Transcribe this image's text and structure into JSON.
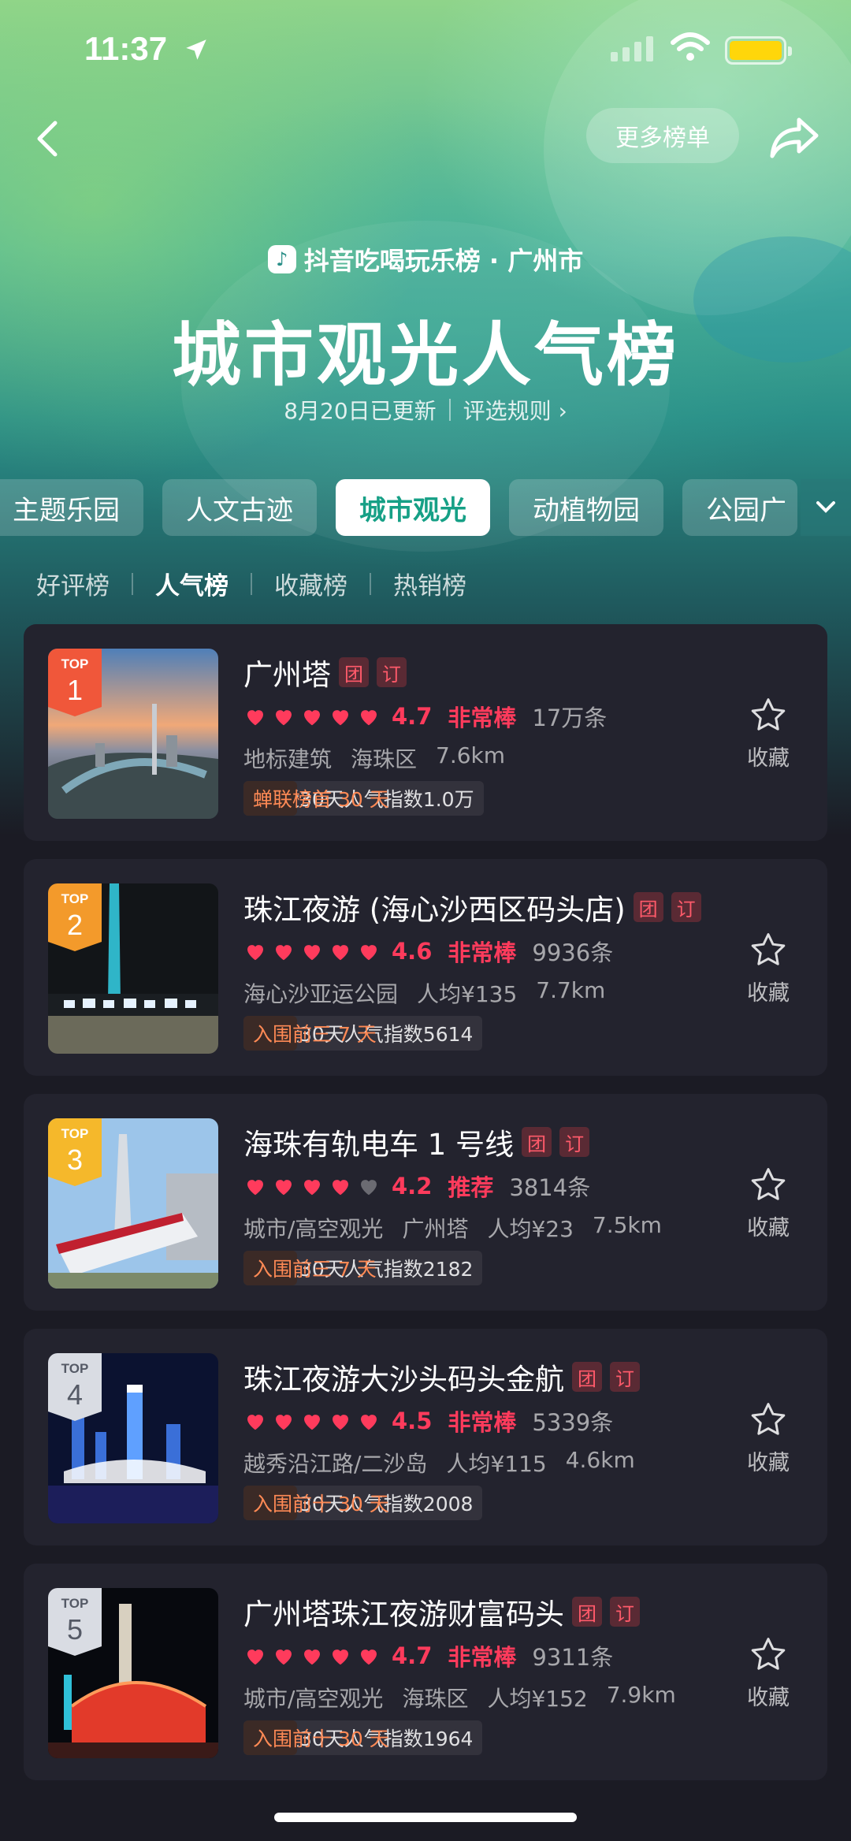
{
  "status_bar": {
    "time": "11:37"
  },
  "header": {
    "more_lists": "更多榜单",
    "brand": "抖音吃喝玩乐榜 · 广州市",
    "title": "城市观光人气榜",
    "updated": "8月20日已更新",
    "rules": "评选规则"
  },
  "categories": [
    "主题乐园",
    "人文古迹",
    "城市观光",
    "动植物园",
    "公园广"
  ],
  "active_category": "城市观光",
  "sub_tabs": [
    "好评榜",
    "人气榜",
    "收藏榜",
    "热销榜"
  ],
  "active_sub_tab": "人气榜",
  "favorite_label": "收藏",
  "top_label": "TOP",
  "tag_group": "团",
  "tag_order": "订",
  "items": [
    {
      "rank": "1",
      "name": "广州塔",
      "rating": 4.7,
      "score": "4.7",
      "level": "非常棒",
      "reviews": "17万条",
      "meta": [
        "地标建筑",
        "海珠区",
        "7.6km"
      ],
      "popularity": "近30天人气指数1.0万",
      "badge": "蝉联榜首 30 天",
      "rank_color": "#f0573a"
    },
    {
      "rank": "2",
      "name": "珠江夜游 (海心沙西区码头店)",
      "rating": 4.6,
      "score": "4.6",
      "level": "非常棒",
      "reviews": "9936条",
      "meta": [
        "海心沙亚运公园",
        "人均¥135",
        "7.7km"
      ],
      "popularity": "近30天人气指数5614",
      "badge": "入围前三 7 天",
      "rank_color": "#f39a2b"
    },
    {
      "rank": "3",
      "name": "海珠有轨电车 1 号线",
      "rating": 4.2,
      "score": "4.2",
      "level": "推荐",
      "reviews": "3814条",
      "meta": [
        "城市/高空观光",
        "广州塔",
        "人均¥23",
        "7.5km"
      ],
      "popularity": "近30天人气指数2182",
      "badge": "入围前三 7 天",
      "rank_color": "#f5b82b"
    },
    {
      "rank": "4",
      "name": "珠江夜游大沙头码头金航",
      "rating": 4.5,
      "score": "4.5",
      "level": "非常棒",
      "reviews": "5339条",
      "meta": [
        "越秀沿江路/二沙岛",
        "人均¥115",
        "4.6km"
      ],
      "popularity": "近30天人气指数2008",
      "badge": "入围前十 30 天",
      "rank_color": "#d9dce3"
    },
    {
      "rank": "5",
      "name": "广州塔珠江夜游财富码头",
      "rating": 4.7,
      "score": "4.7",
      "level": "非常棒",
      "reviews": "9311条",
      "meta": [
        "城市/高空观光",
        "海珠区",
        "人均¥152",
        "7.9km"
      ],
      "popularity": "近30天人气指数1964",
      "badge": "入围前十 30 天",
      "rank_color": "#d9dce3"
    }
  ],
  "colors": {
    "accent": "#16a086",
    "heart": "#ff3b5c",
    "badge_text": "#ff8a55"
  }
}
